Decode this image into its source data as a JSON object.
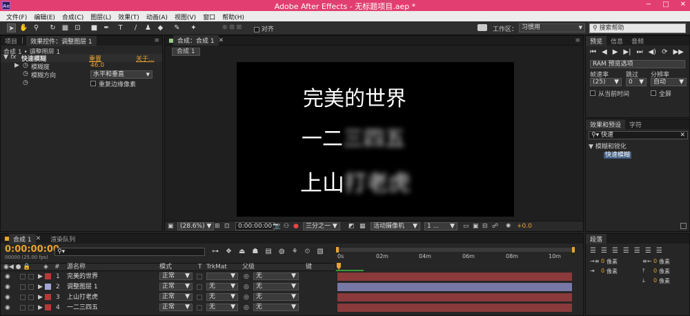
{
  "window": {
    "title": "Adobe After Effects - 无标题项目.aep *",
    "logo": "Ae",
    "minimize": "−",
    "maximize": "□",
    "close": "✕"
  },
  "menu": [
    "文件(F)",
    "编辑(E)",
    "合成(C)",
    "图层(L)",
    "效果(T)",
    "动画(A)",
    "视图(V)",
    "窗口",
    "帮助(H)"
  ],
  "toolbar": {
    "align_label": "对齐",
    "workspace_label": "工作区：",
    "workspace_value": "习惯用",
    "search_placeholder": "搜索帮助"
  },
  "left_panel": {
    "tab_project": "项目",
    "tab_effects": "效果控件：调整图层 1",
    "breadcrumb": "合成 1 • 调整图层 1",
    "effect_icon": "fx",
    "effect_name": "快速模糊",
    "reset_link": "重置",
    "about_link": "关于...",
    "blurriness_label": "模糊度",
    "blurriness_value": "46.0",
    "direction_label": "模糊方向",
    "direction_value": "水平和垂直",
    "repeat_label": "重复边缘像素"
  },
  "comp_panel": {
    "tab_label": "合成：合成 1",
    "subtab": "合成 1",
    "line1": "完美的世界",
    "line2_clear": "一二",
    "line2_blur": "三四五",
    "line3_clear": "上山",
    "line3_blur": "打老虎",
    "zoom": "(28.6%)",
    "timecode": "0:00:00:00",
    "resolution": "三分之一",
    "camera": "活动摄像机",
    "views": "1 ...",
    "exposure": "+0.0"
  },
  "preview_panel": {
    "tabs": [
      "预览",
      "信息",
      "音频"
    ],
    "ram_label": "RAM 预览选项",
    "fps_label": "帧速率",
    "skip_label": "跳过",
    "res_label": "分辨率",
    "fps_value": "(25)",
    "skip_value": "0",
    "res_value": "自动",
    "from_current": "从当前时间",
    "fullscreen": "全屏"
  },
  "effects_panel": {
    "tabs": [
      "效果和预设",
      "字符"
    ],
    "search_value": "快速",
    "category": "模糊和锐化",
    "item": "快速模糊"
  },
  "timeline": {
    "tab_comp": "合成 1",
    "tab_render": "渲染队列",
    "current_time": "0:00:00:00",
    "fps_info": "00000 (25.00 fps)",
    "col_num": "#",
    "col_name": "源名称",
    "col_mode": "模式",
    "col_t": "T",
    "col_trkmat": "TrkMat",
    "col_parent": "父级",
    "col_key": "键",
    "ruler": [
      "0s",
      "02m",
      "04m",
      "06m",
      "08m",
      "10m"
    ],
    "layers": [
      {
        "num": "1",
        "name": "完美的世界",
        "mode": "正常",
        "trkmat": "",
        "parent": "无",
        "color": "#b33a3a",
        "bar": "#8a3a3a"
      },
      {
        "num": "2",
        "name": "调整图层 1",
        "mode": "正常",
        "trkmat": "无",
        "parent": "无",
        "color": "#a3a3d6",
        "bar": "#7878a6"
      },
      {
        "num": "3",
        "name": "上山打老虎",
        "mode": "正常",
        "trkmat": "无",
        "parent": "无",
        "color": "#b33a3a",
        "bar": "#8a3a3a"
      },
      {
        "num": "4",
        "name": "一二三四五",
        "mode": "正常",
        "trkmat": "无",
        "parent": "无",
        "color": "#b33a3a",
        "bar": "#8a3a3a"
      }
    ]
  },
  "paragraph_panel": {
    "tab": "段落",
    "unit": "像素",
    "values": [
      "0",
      "0",
      "0",
      "0",
      "0"
    ]
  }
}
